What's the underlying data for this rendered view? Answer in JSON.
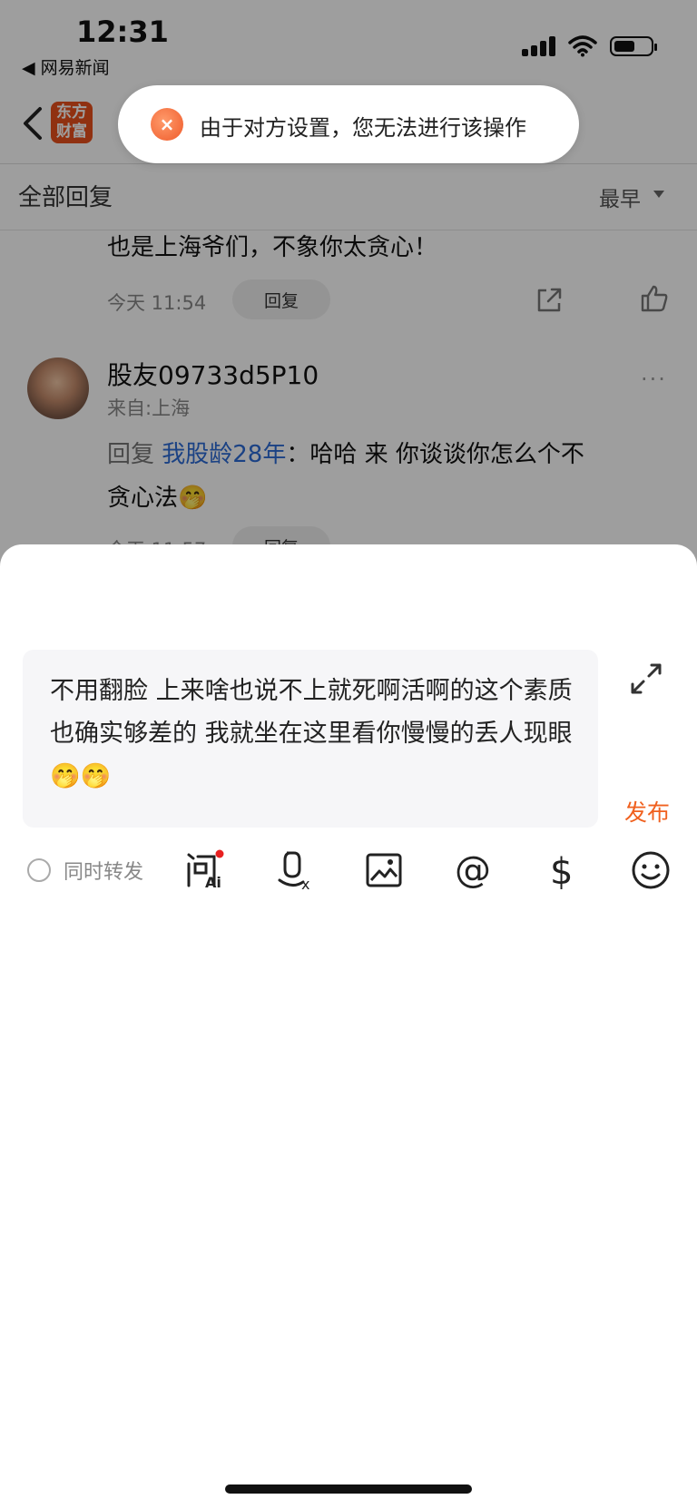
{
  "status_bar": {
    "time": "12:31",
    "back_app": "◀ 网易新闻"
  },
  "nav": {
    "logo_line1": "东方",
    "logo_line2": "财富"
  },
  "toast": {
    "icon": "×",
    "message": "由于对方设置，您无法进行该操作"
  },
  "sort_bar": {
    "title": "全部回复",
    "sort_value": "最早"
  },
  "comments": [
    {
      "text": "也是上海爷们，不象你太贪心！",
      "time": "今天 11:54",
      "reply_label": "回复"
    },
    {
      "username": "股友09733d5P10",
      "from": "来自:上海",
      "more": "···",
      "reply_prefix": "回复 ",
      "reply_target": "我股龄28年",
      "reply_sep": "：",
      "text_line1": "哈哈 来 你谈谈你怎么个不",
      "text_line2": "贪心法🤭",
      "time": "今天 11:57",
      "reply_label": "回复"
    }
  ],
  "composer": {
    "input_value": "不用翻脸 上来啥也说不上就死啊活啊的这个素质也确实够差的 我就坐在这里看你慢慢的丢人现眼🤭🤭",
    "publish_label": "发布",
    "forward_label": "同时转发",
    "tools": [
      {
        "name": "ask-ai-icon"
      },
      {
        "name": "voice-to-text-icon"
      },
      {
        "name": "image-icon"
      },
      {
        "name": "mention-icon"
      },
      {
        "name": "dollar-icon"
      },
      {
        "name": "emoji-icon"
      }
    ]
  },
  "colors": {
    "accent": "#f0601e",
    "link": "#2d6bd6",
    "logo": "#e8501c"
  }
}
